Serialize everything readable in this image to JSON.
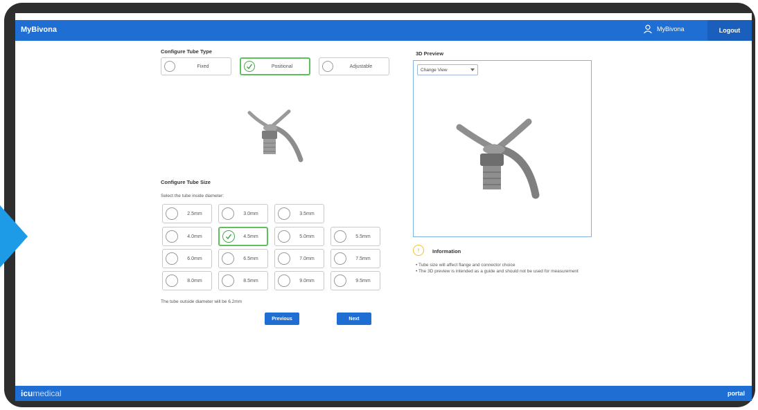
{
  "header": {
    "brand": "MyBivona",
    "user_label": "MyBivona",
    "logout_label": "Logout"
  },
  "tube_type": {
    "title": "Configure Tube Type",
    "options": [
      {
        "label": "Fixed",
        "selected": false
      },
      {
        "label": "Positional",
        "selected": true
      },
      {
        "label": "Adjustable",
        "selected": false
      }
    ]
  },
  "tube_size": {
    "title": "Configure Tube Size",
    "instruction": "Select the tube inside diameter:",
    "options": [
      {
        "label": "2.5mm",
        "selected": false
      },
      {
        "label": "3.0mm",
        "selected": false
      },
      {
        "label": "3.5mm",
        "selected": false
      },
      {
        "label": "4.0mm",
        "selected": false
      },
      {
        "label": "4.5mm",
        "selected": true
      },
      {
        "label": "5.0mm",
        "selected": false
      },
      {
        "label": "5.5mm",
        "selected": false
      },
      {
        "label": "6.0mm",
        "selected": false
      },
      {
        "label": "6.5mm",
        "selected": false
      },
      {
        "label": "7.0mm",
        "selected": false
      },
      {
        "label": "7.5mm",
        "selected": false
      },
      {
        "label": "8.0mm",
        "selected": false
      },
      {
        "label": "8.5mm",
        "selected": false
      },
      {
        "label": "9.0mm",
        "selected": false
      },
      {
        "label": "9.5mm",
        "selected": false
      }
    ],
    "outside_diameter_note": "The tube outside diameter will be 6.2mm"
  },
  "buttons": {
    "previous": "Previous",
    "next": "Next"
  },
  "preview": {
    "title": "3D Preview",
    "change_view": "Change View"
  },
  "information": {
    "title": "Information",
    "bullets": [
      "• Tube size will affect flange and connector choice",
      "• The 3D preview is intended as a guide and should not be used for measurement"
    ]
  },
  "footer": {
    "logo_bold": "icu",
    "logo_light": "medical",
    "right_label": "portal"
  },
  "colors": {
    "primary": "#1f6ed4",
    "selected": "#5cc15c",
    "info": "#f2c230"
  }
}
